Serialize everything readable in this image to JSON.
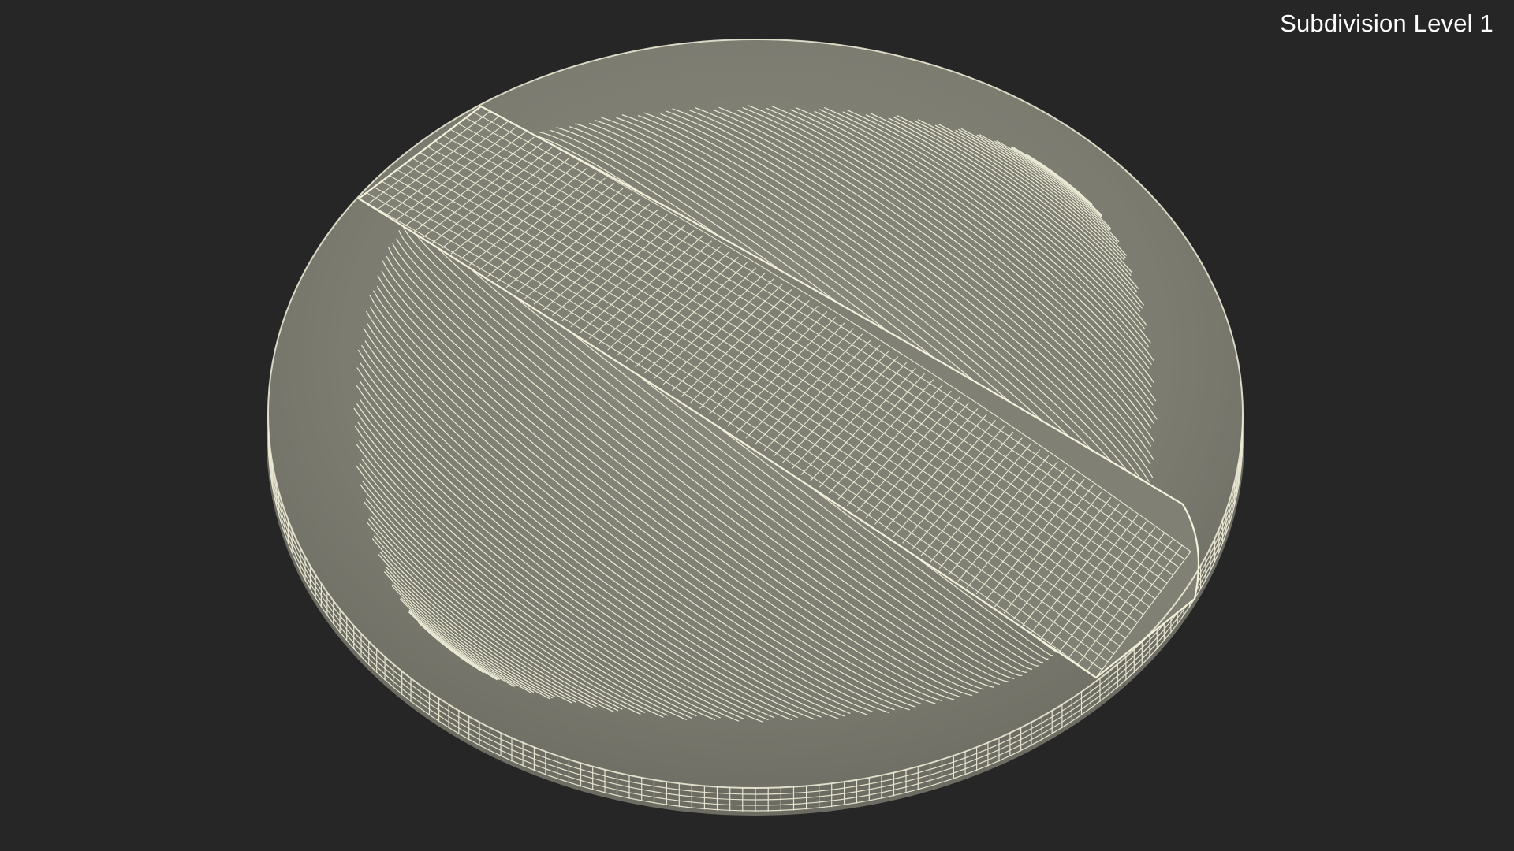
{
  "viewport": {
    "label": "Subdivision Level 1",
    "background_color": "#262626"
  },
  "model": {
    "object": "wireframe-puff-pad",
    "surface_color": "#7f7f74",
    "wire_color": "#f4f2dc"
  }
}
